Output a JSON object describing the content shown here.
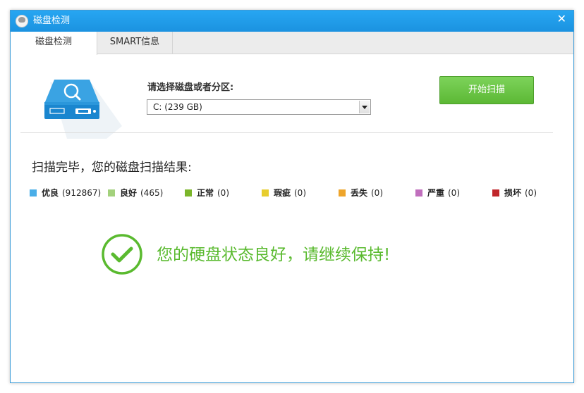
{
  "window": {
    "title": "磁盘检测"
  },
  "tabs": [
    {
      "label": "磁盘检测",
      "active": true
    },
    {
      "label": "SMART信息",
      "active": false
    }
  ],
  "select": {
    "label": "请选择磁盘或者分区:",
    "value": "C:  (239 GB)"
  },
  "start_button": {
    "label": "开始扫描",
    "color": "#62bd3b"
  },
  "result": {
    "title": "扫描完毕，您的磁盘扫描结果:"
  },
  "legend": [
    {
      "name": "优良",
      "count": "(912867)",
      "color": "#4aaee8"
    },
    {
      "name": "良好",
      "count": "(465)",
      "color": "#a3d17c"
    },
    {
      "name": "正常",
      "count": "(0)",
      "color": "#7bb62a"
    },
    {
      "name": "瑕疵",
      "count": "(0)",
      "color": "#e7cd2e"
    },
    {
      "name": "丢失",
      "count": "(0)",
      "color": "#eea52b"
    },
    {
      "name": "严重",
      "count": "(0)",
      "color": "#c06fbd"
    },
    {
      "name": "损坏",
      "count": "(0)",
      "color": "#c0262b"
    }
  ],
  "status": {
    "message": "您的硬盘状态良好，请继续保持!",
    "color": "#5aba2f"
  },
  "icons": {
    "title": "app-logo-icon",
    "close": "close-icon",
    "hdd": "hard-disk-search-icon",
    "status": "check-circle-icon"
  }
}
